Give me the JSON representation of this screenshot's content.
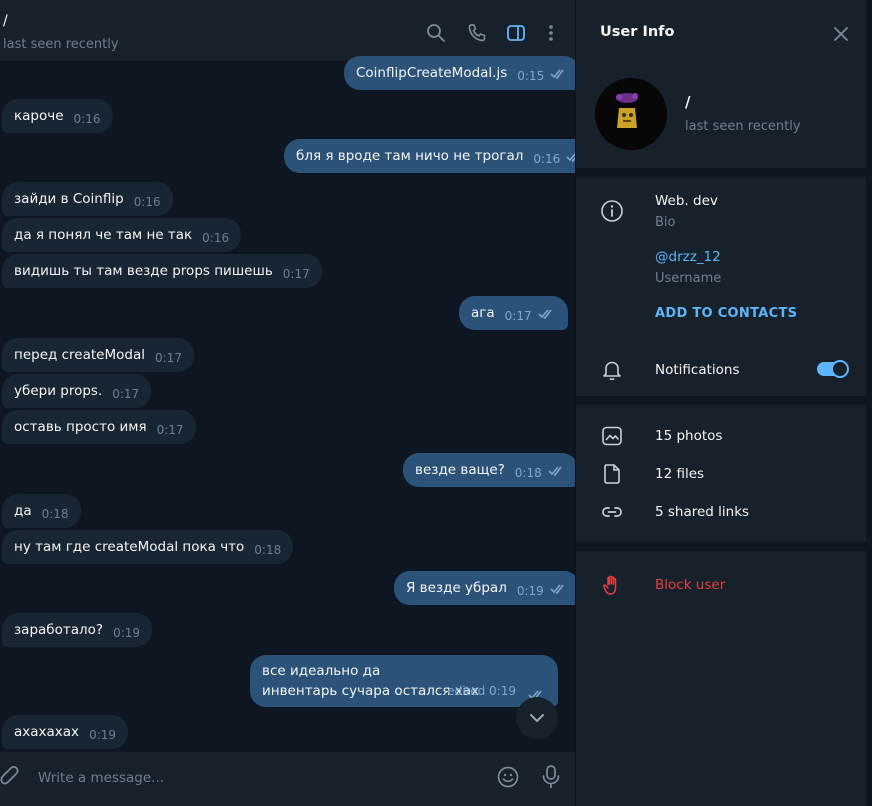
{
  "chat": {
    "title": "/",
    "status": "last seen recently",
    "header_icons": [
      "search-icon",
      "phone-icon",
      "sidebar-toggle-icon",
      "more-vertical-icon"
    ],
    "composer_placeholder": "Write a message...",
    "messages": [
      {
        "dir": "out",
        "text": "CoinflipCreateModal.js",
        "time": "0:15"
      },
      {
        "dir": "in",
        "text": "кароче",
        "time": "0:16"
      },
      {
        "dir": "out",
        "text": "бля я вроде там ничо не трогал",
        "time": "0:16"
      },
      {
        "dir": "in",
        "text": "зайди в Coinflip",
        "time": "0:16"
      },
      {
        "dir": "in",
        "text": "да я понял че там не так",
        "time": "0:16"
      },
      {
        "dir": "in",
        "text": "видишь ты там везде props пишешь",
        "time": "0:17"
      },
      {
        "dir": "out",
        "text": "ага",
        "time": "0:17"
      },
      {
        "dir": "in",
        "text": "перед createModal",
        "time": "0:17"
      },
      {
        "dir": "in",
        "text": "убери props.",
        "time": "0:17"
      },
      {
        "dir": "in",
        "text": "оставь просто имя",
        "time": "0:17"
      },
      {
        "dir": "out",
        "text": "везде ваще?",
        "time": "0:18"
      },
      {
        "dir": "in",
        "text": "да",
        "time": "0:18"
      },
      {
        "dir": "in",
        "text": "ну там где createModal пока что",
        "time": "0:18"
      },
      {
        "dir": "out",
        "text": "Я везде убрал",
        "time": "0:19"
      },
      {
        "dir": "in",
        "text": "заработало?",
        "time": "0:19"
      },
      {
        "dir": "out",
        "line1": "все идеально да",
        "line2": "инвентарь сучара остался хах",
        "time": "edited 0:19"
      },
      {
        "dir": "in",
        "text": "ахахахах",
        "time": "0:19"
      }
    ]
  },
  "info": {
    "title": "User Info",
    "name": "/",
    "status": "last seen recently",
    "bio": "Web. dev",
    "bio_label": "Bio",
    "username": "@drzz_12",
    "username_label": "Username",
    "add_contacts": "ADD TO CONTACTS",
    "notifications": "Notifications",
    "notifications_on": true,
    "photos": "15 photos",
    "files": "12 files",
    "links": "5 shared links",
    "block": "Block user"
  },
  "colors": {
    "bg": "#0e1621",
    "panel": "#17212b",
    "bubble_in": "#182533",
    "bubble_out": "#2b5278",
    "accent": "#5eb5f7",
    "muted": "#6d7f8f",
    "danger": "#e53e3e"
  }
}
